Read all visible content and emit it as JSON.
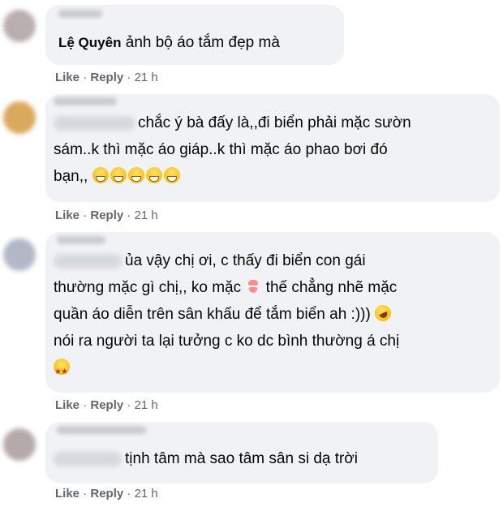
{
  "actions": {
    "like": "Like",
    "reply": "Reply",
    "separator": " · "
  },
  "comments": [
    {
      "author": "Lệ Quyên",
      "lines": [
        "ảnh bộ áo tắm đẹp mà"
      ],
      "time": "21 h"
    },
    {
      "lines": [
        "chắc ý bà đấy là,,đi biển phải mặc sườn",
        "sám..k thì mặc áo giáp..k thì mặc áo phao bơi đó",
        "bạn,,"
      ],
      "emojis": [
        "grinning-face",
        "grinning-face",
        "grinning-face",
        "grinning-face",
        "grinning-face"
      ],
      "time": "21 h"
    },
    {
      "lines": [
        "ủa vậy chị ơi, c thấy đi biển con gái",
        "thường mặc gì chị,, ko mặc",
        "thế chẳng nhẽ mặc",
        "quần áo diễn trên sân khấu để tắm biển ah :)))",
        "nói ra người ta lại tưởng c ko dc bình thường á chị"
      ],
      "emojis": [
        "bikini",
        "rolling-on-floor-laughing",
        "star-struck"
      ],
      "time": "21 h"
    },
    {
      "lines": [
        "tịnh tâm mà sao tâm sân si dạ trời"
      ],
      "time": "21 h"
    }
  ]
}
